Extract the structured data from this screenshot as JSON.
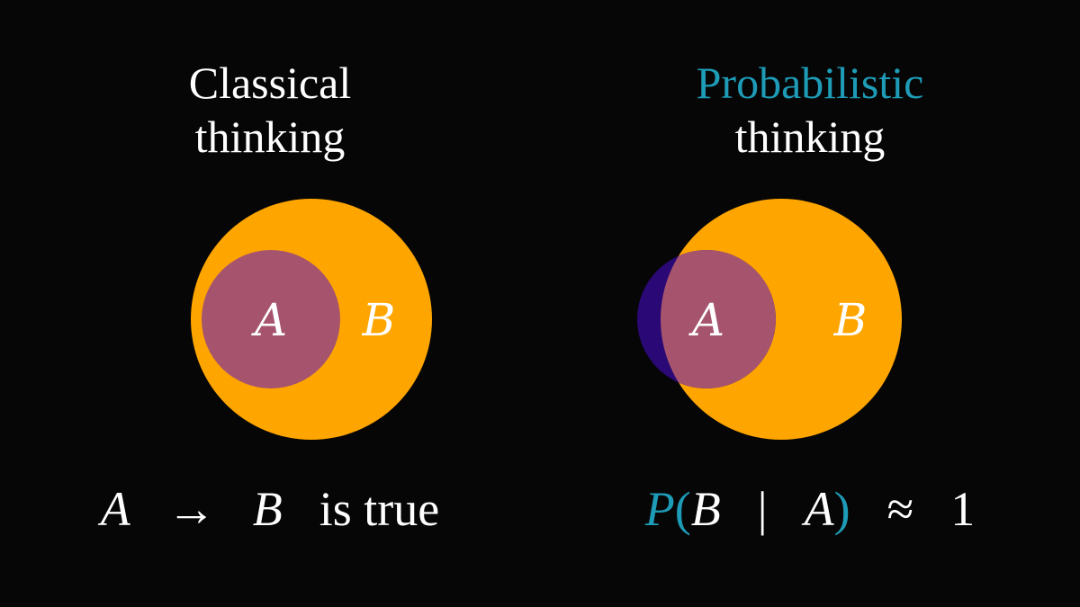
{
  "colors": {
    "background": "#060606",
    "set_b": "#ffa500",
    "set_a": "#a6546e",
    "set_a_outside_b": "#2a0875",
    "accent": "#1e9bb6",
    "text": "#ffffff"
  },
  "classical": {
    "title_line1": "Classical",
    "title_line2": "thinking",
    "label_a": "A",
    "label_b": "B",
    "formula": {
      "lhs": "A",
      "arrow": "→",
      "rhs": "B",
      "suffix": "is true"
    }
  },
  "probabilistic": {
    "title_line1": "Probabilistic",
    "title_line2": "thinking",
    "label_a": "A",
    "label_b": "B",
    "formula": {
      "p": "P",
      "open_paren": "(",
      "event": "B",
      "bar": "|",
      "given": "A",
      "close_paren": ")",
      "approx": "≈",
      "value": "1"
    }
  }
}
